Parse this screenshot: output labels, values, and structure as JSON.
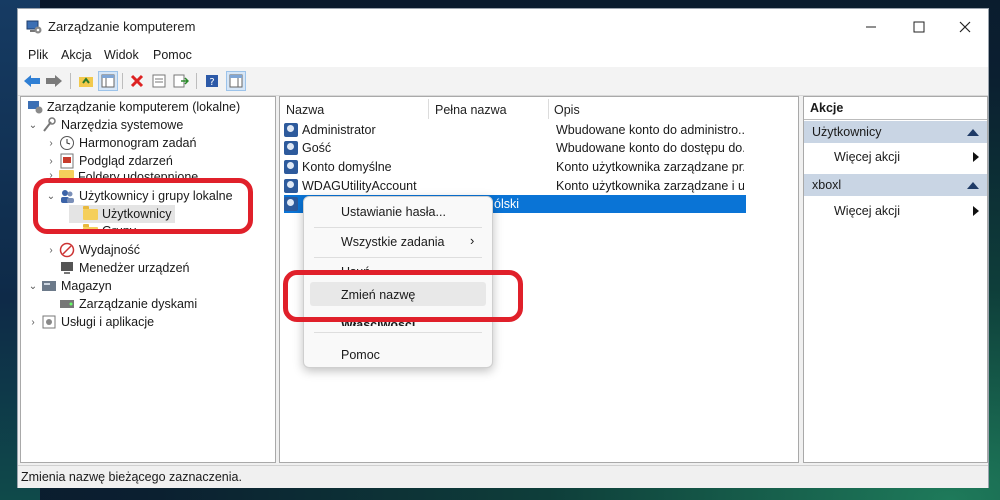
{
  "window": {
    "title": "Zarządzanie komputerem"
  },
  "menu": [
    "Plik",
    "Akcja",
    "Widok",
    "Pomoc"
  ],
  "tree": {
    "root": "Zarządzanie komputerem (lokalne)",
    "system_tools": "Narzędzia systemowe",
    "task_scheduler": "Harmonogram zadań",
    "event_viewer": "Podgląd zdarzeń",
    "shared_folders": "Foldery udostępnione",
    "local_users": "Użytkownicy i grupy lokalne",
    "users": "Użytkownicy",
    "groups": "Grupy",
    "performance": "Wydajność",
    "device_manager": "Menedżer urządzeń",
    "storage": "Magazyn",
    "disk_management": "Zarządzanie dyskami",
    "services": "Usługi i aplikacje"
  },
  "columns": {
    "name": "Nazwa",
    "full_name": "Pełna nazwa",
    "description": "Opis"
  },
  "users": [
    {
      "name": "Administrator",
      "full_name": "",
      "desc": "Wbudowane konto do administro..."
    },
    {
      "name": "Gość",
      "full_name": "",
      "desc": "Wbudowane konto do dostępu do..."
    },
    {
      "name": "Konto domyślne",
      "full_name": "",
      "desc": "Konto użytkownika zarządzane prz..."
    },
    {
      "name": "WDAGUtilityAccount",
      "full_name": "",
      "desc": "Konto użytkownika zarządzane i u..."
    }
  ],
  "selected_row_fragment": "ólski",
  "context_menu": {
    "set_password": "Ustawianie hasła...",
    "all_tasks": "Wszystkie zadania",
    "delete_partial": "Usuń",
    "rename": "Zmień nazwę",
    "properties": "Właściwości",
    "help": "Pomoc"
  },
  "actions": {
    "header": "Akcje",
    "section1": "Użytkownicy",
    "more1": "Więcej akcji",
    "section2": "xboxl",
    "more2": "Więcej akcji"
  },
  "status": "Zmienia nazwę bieżącego zaznaczenia.",
  "colors": {
    "selection": "#0a74d6",
    "annotation": "#e0202a",
    "actions_header": "#c9d5e4"
  }
}
